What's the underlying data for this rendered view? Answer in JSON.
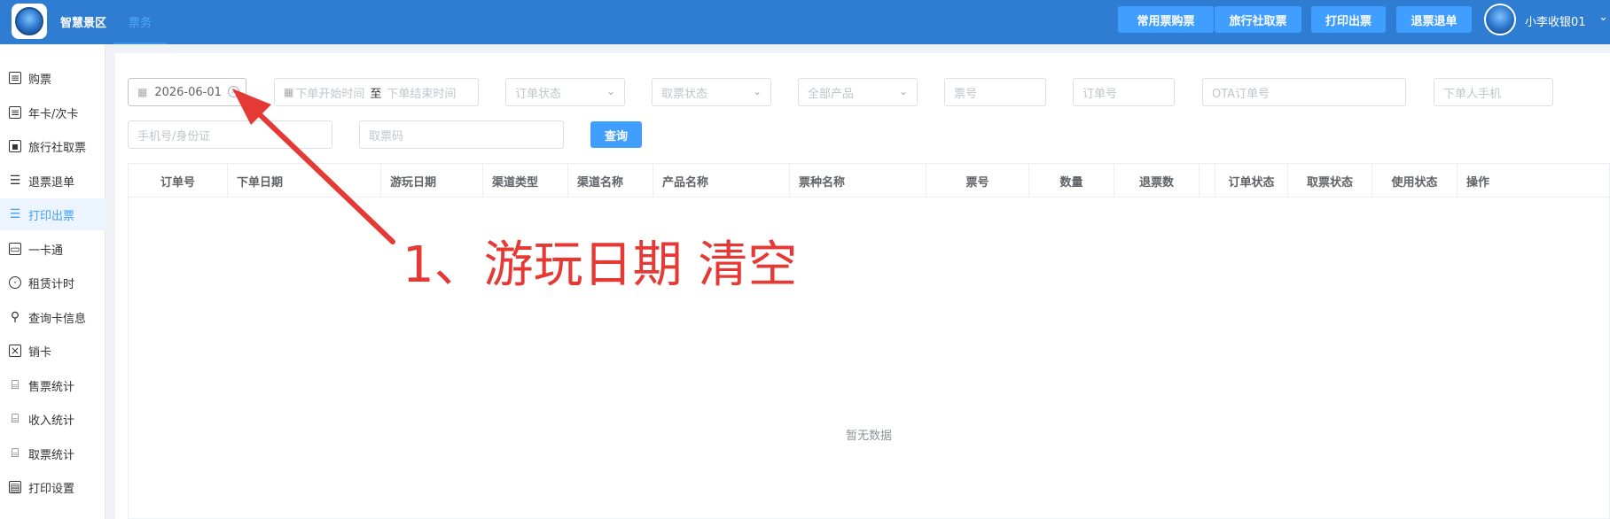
{
  "header": {
    "app_name": "智慧景区",
    "nav_tab": "票务",
    "buttons": [
      "常用票购票",
      "旅行社取票",
      "打印出票",
      "退票退单"
    ],
    "user_name": "小李收银01",
    "accent_color": "#2f7dd2",
    "button_color": "#409eff"
  },
  "sidebar": {
    "items": [
      {
        "label": "购票",
        "icon": "document-icon"
      },
      {
        "label": "年卡/次卡",
        "icon": "document-icon"
      },
      {
        "label": "旅行社取票",
        "icon": "save-icon"
      },
      {
        "label": "退票退单",
        "icon": "sliders-icon"
      },
      {
        "label": "打印出票",
        "icon": "sliders-icon",
        "active": true
      },
      {
        "label": "一卡通",
        "icon": "card-icon"
      },
      {
        "label": "租赁计时",
        "icon": "stopwatch-icon"
      },
      {
        "label": "查询卡信息",
        "icon": "user-icon"
      },
      {
        "label": "销卡",
        "icon": "file-x-icon"
      },
      {
        "label": "售票统计",
        "icon": "easel-icon"
      },
      {
        "label": "收入统计",
        "icon": "easel-icon"
      },
      {
        "label": "取票统计",
        "icon": "easel-icon"
      },
      {
        "label": "打印设置",
        "icon": "printer-settings-icon"
      }
    ]
  },
  "filters": {
    "play_date": "2026-06-01",
    "order_start_placeholder": "下单开始时间",
    "range_separator": "至",
    "order_end_placeholder": "下单结束时间",
    "order_status_placeholder": "订单状态",
    "pickup_status_placeholder": "取票状态",
    "product_placeholder": "全部产品",
    "ticket_no_placeholder": "票号",
    "order_no_placeholder": "订单号",
    "ota_order_placeholder": "OTA订单号",
    "buyer_phone_placeholder": "下单人手机",
    "phone_id_placeholder": "手机号/身份证",
    "pickup_code_placeholder": "取票码",
    "query_label": "查询"
  },
  "table": {
    "columns": [
      "订单号",
      "下单日期",
      "游玩日期",
      "渠道类型",
      "渠道名称",
      "产品名称",
      "票种名称",
      "票号",
      "数量",
      "退票数",
      "",
      "订单状态",
      "取票状态",
      "使用状态",
      "操作"
    ],
    "empty_text": "暂无数据"
  },
  "annotation": {
    "text": "1、游玩日期 清空",
    "color": "#e53935"
  }
}
